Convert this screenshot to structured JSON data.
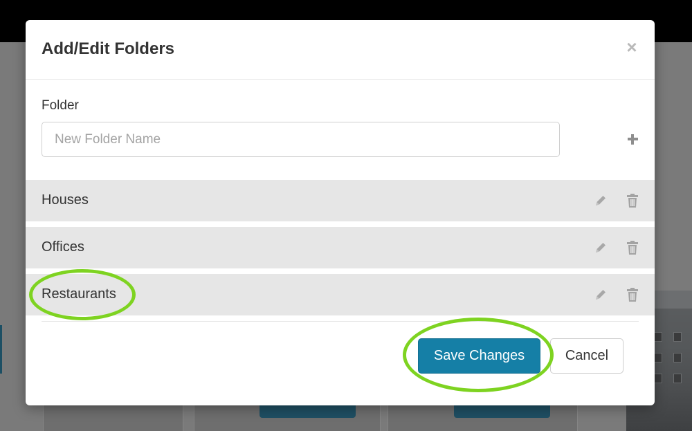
{
  "modal": {
    "title": "Add/Edit Folders",
    "close_label": "×"
  },
  "folder_form": {
    "label": "Folder",
    "input_value": "",
    "input_placeholder": "New Folder Name",
    "add_icon": "plus-icon"
  },
  "folders": [
    {
      "name": "Houses",
      "edit_icon": "pencil-icon",
      "delete_icon": "trash-icon"
    },
    {
      "name": "Offices",
      "edit_icon": "pencil-icon",
      "delete_icon": "trash-icon"
    },
    {
      "name": "Restaurants",
      "edit_icon": "pencil-icon",
      "delete_icon": "trash-icon"
    }
  ],
  "footer": {
    "save_label": "Save Changes",
    "cancel_label": "Cancel"
  },
  "colors": {
    "primary_button": "#157fa6",
    "row_background": "#e6e6e6",
    "annotation": "#7ed321",
    "topbar": "#000000",
    "overlay": "#7a7a7a"
  },
  "annotations": {
    "highlighted_items": [
      "Restaurants",
      "Save Changes"
    ]
  }
}
